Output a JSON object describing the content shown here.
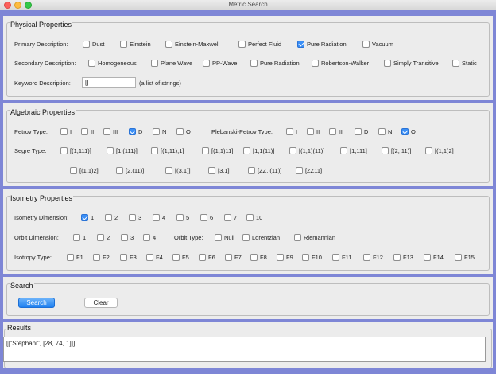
{
  "window": {
    "title": "Metric Search"
  },
  "physical": {
    "title": "Physical Properties",
    "primary_label": "Primary Description:",
    "primary_options": [
      {
        "label": "Dust",
        "checked": false
      },
      {
        "label": "Einstein",
        "checked": false
      },
      {
        "label": "Einstein-Maxwell",
        "checked": false
      },
      {
        "label": "Perfect Fluid",
        "checked": false
      },
      {
        "label": "Pure Radiation",
        "checked": true
      },
      {
        "label": "Vacuum",
        "checked": false
      }
    ],
    "secondary_label": "Secondary Description:",
    "secondary_options": [
      {
        "label": "Homogeneous",
        "checked": false
      },
      {
        "label": "Plane Wave",
        "checked": false
      },
      {
        "label": "PP-Wave",
        "checked": false
      },
      {
        "label": "Pure Radiation",
        "checked": false
      },
      {
        "label": "Robertson-Walker",
        "checked": false
      },
      {
        "label": "Simply Transitive",
        "checked": false
      },
      {
        "label": "Static",
        "checked": false
      }
    ],
    "keyword_label": "Keyword Description:",
    "keyword_value": "[]",
    "keyword_hint": "(a list of strings)"
  },
  "algebraic": {
    "title": "Algebraic Properties",
    "petrov_label": "Petrov Type:",
    "petrov_options": [
      {
        "label": "I",
        "checked": false
      },
      {
        "label": "II",
        "checked": false
      },
      {
        "label": "III",
        "checked": false
      },
      {
        "label": "D",
        "checked": true
      },
      {
        "label": "N",
        "checked": false
      },
      {
        "label": "O",
        "checked": false
      }
    ],
    "plebanski_label": "Plebanski-Petrov Type:",
    "plebanski_options": [
      {
        "label": "I",
        "checked": false
      },
      {
        "label": "II",
        "checked": false
      },
      {
        "label": "III",
        "checked": false
      },
      {
        "label": "D",
        "checked": false
      },
      {
        "label": "N",
        "checked": false
      },
      {
        "label": "O",
        "checked": true
      }
    ],
    "segre_label": "Segre Type:",
    "segre_row1": [
      {
        "label": "[(1,111)]",
        "checked": false
      },
      {
        "label": "[1,(111)]",
        "checked": false
      },
      {
        "label": "[(1,11),1]",
        "checked": false
      },
      {
        "label": "[(1,1)11]",
        "checked": false
      },
      {
        "label": "[1,1(11)]",
        "checked": false
      },
      {
        "label": "[(1,1)(11)]",
        "checked": false
      },
      {
        "label": "[1,111]",
        "checked": false
      },
      {
        "label": "[(2, 11)]",
        "checked": false
      },
      {
        "label": "[(1,1)2]",
        "checked": false
      }
    ],
    "segre_row2": [
      {
        "label": "[(1,1)2]",
        "checked": false
      },
      {
        "label": "[2,(11)]",
        "checked": false
      },
      {
        "label": "[(3,1)]",
        "checked": false
      },
      {
        "label": "[3,1]",
        "checked": false
      },
      {
        "label": "[ZZ, (11)]",
        "checked": false
      },
      {
        "label": "[ZZ11]",
        "checked": false
      }
    ]
  },
  "isometry": {
    "title": "Isometry Properties",
    "dim_label": "Isometry Dimension:",
    "dim_options": [
      {
        "label": "1",
        "checked": true
      },
      {
        "label": "2",
        "checked": false
      },
      {
        "label": "3",
        "checked": false
      },
      {
        "label": "4",
        "checked": false
      },
      {
        "label": "5",
        "checked": false
      },
      {
        "label": "6",
        "checked": false
      },
      {
        "label": "7",
        "checked": false
      },
      {
        "label": "10",
        "checked": false
      }
    ],
    "orbit_dim_label": "Orbit Dimension:",
    "orbit_dim_options": [
      {
        "label": "1",
        "checked": false
      },
      {
        "label": "2",
        "checked": false
      },
      {
        "label": "3",
        "checked": false
      },
      {
        "label": "4",
        "checked": false
      }
    ],
    "orbit_type_label": "Orbit Type:",
    "orbit_type_options": [
      {
        "label": "Null",
        "checked": false
      },
      {
        "label": "Lorentzian",
        "checked": false
      },
      {
        "label": "Riemannian",
        "checked": false
      }
    ],
    "isotropy_label": "Isotropy Type:",
    "isotropy_options": [
      {
        "label": "F1",
        "checked": false
      },
      {
        "label": "F2",
        "checked": false
      },
      {
        "label": "F3",
        "checked": false
      },
      {
        "label": "F4",
        "checked": false
      },
      {
        "label": "F5",
        "checked": false
      },
      {
        "label": "F6",
        "checked": false
      },
      {
        "label": "F7",
        "checked": false
      },
      {
        "label": "F8",
        "checked": false
      },
      {
        "label": "F9",
        "checked": false
      },
      {
        "label": "F10",
        "checked": false
      },
      {
        "label": "F11",
        "checked": false
      },
      {
        "label": "F12",
        "checked": false
      },
      {
        "label": "F13",
        "checked": false
      },
      {
        "label": "F14",
        "checked": false
      },
      {
        "label": "F15",
        "checked": false
      }
    ]
  },
  "search": {
    "title": "Search",
    "search_label": "Search",
    "clear_label": "Clear"
  },
  "results": {
    "title": "Results",
    "text": "[[\"Stephani\", [28, 74, 1]]]"
  }
}
